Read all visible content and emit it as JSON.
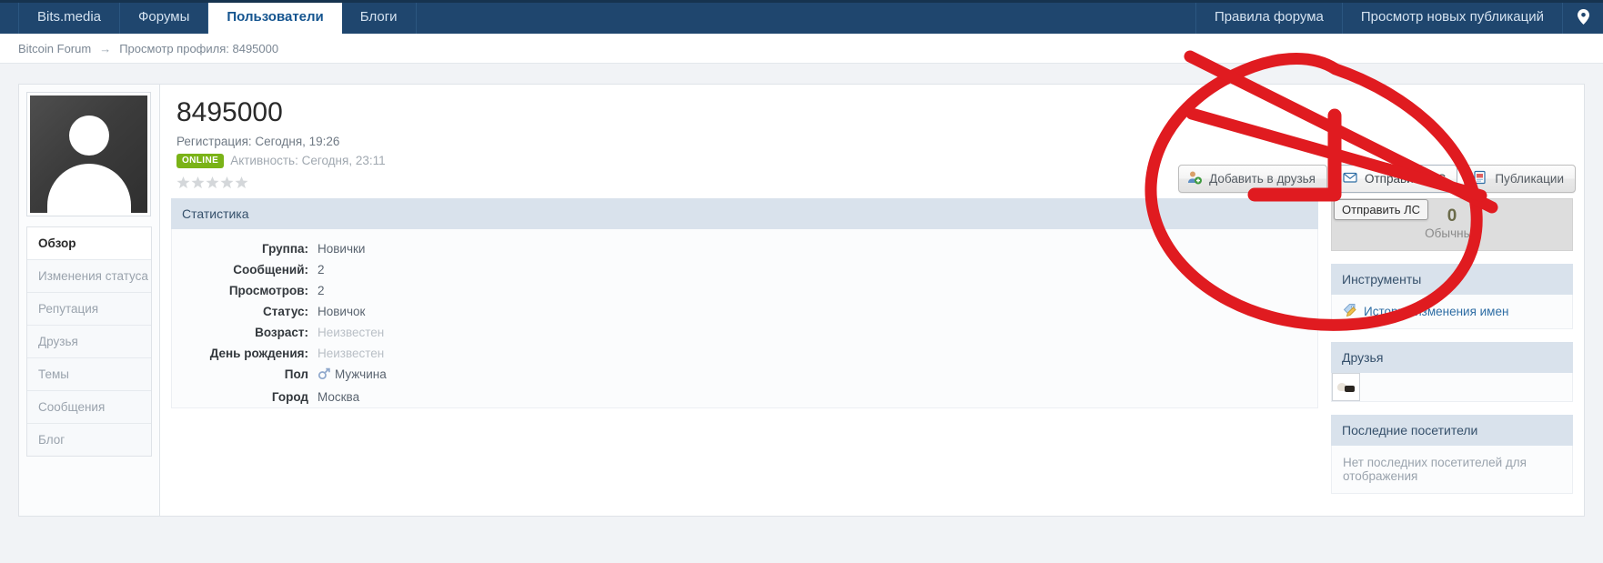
{
  "navbar": {
    "left_items": [
      {
        "label": "Bits.media",
        "active": false
      },
      {
        "label": "Форумы",
        "active": false
      },
      {
        "label": "Пользователи",
        "active": true
      },
      {
        "label": "Блоги",
        "active": false
      }
    ],
    "right_items": [
      {
        "label": "Правила форума"
      },
      {
        "label": "Просмотр новых публикаций"
      }
    ],
    "location_icon": "location-pin-icon",
    "colors": {
      "background": "#1f466e",
      "active_text": "#14548f"
    }
  },
  "breadcrumb": {
    "root": "Bitcoin Forum",
    "separator": "→",
    "current": "Просмотр профиля: 8495000"
  },
  "profile": {
    "avatar_alt": "default-avatar",
    "username": "8495000",
    "registration": "Регистрация: Сегодня, 19:26",
    "online_badge": "ONLINE",
    "activity": "Активность: Сегодня, 23:11",
    "stars": 5,
    "stars_filled": 0
  },
  "profile_tabs": [
    {
      "label": "Обзор",
      "active": true
    },
    {
      "label": "Изменения статуса",
      "active": false
    },
    {
      "label": "Репутация",
      "active": false
    },
    {
      "label": "Друзья",
      "active": false
    },
    {
      "label": "Темы",
      "active": false
    },
    {
      "label": "Сообщения",
      "active": false
    },
    {
      "label": "Блог",
      "active": false
    }
  ],
  "actions": {
    "add_friend": {
      "label": "Добавить в друзья",
      "icon": "add-user-icon"
    },
    "send_pm": {
      "label": "Отправить ЛС",
      "icon": "envelope-icon"
    },
    "posts": {
      "label": "Публикации",
      "icon": "document-icon"
    },
    "tooltip": "Отправить ЛС"
  },
  "statistics": {
    "title": "Статистика",
    "rows": [
      {
        "label": "Группа:",
        "value": "Новички",
        "muted": false
      },
      {
        "label": "Сообщений:",
        "value": "2",
        "muted": false
      },
      {
        "label": "Просмотров:",
        "value": "2",
        "muted": false
      },
      {
        "label": "Статус:",
        "value": "Новичок",
        "muted": false
      },
      {
        "label": "Возраст:",
        "value": "Неизвестен",
        "muted": true
      },
      {
        "label": "День рождения:",
        "value": "Неизвестен",
        "muted": true
      },
      {
        "label": "Пол",
        "value": "Мужчина",
        "muted": false,
        "icon": "male-gender-icon"
      },
      {
        "label": "Город",
        "value": "Москва",
        "muted": false
      }
    ]
  },
  "reputation": {
    "value": "0",
    "label": "Обычный"
  },
  "tools_panel": {
    "title": "Инструменты",
    "items": [
      {
        "label": "История изменения имен",
        "icon": "tag-pencil-icon"
      }
    ]
  },
  "friends_panel": {
    "title": "Друзья",
    "friends": [
      {
        "alt": "friend-avatar-cat"
      }
    ]
  },
  "visitors_panel": {
    "title": "Последние посетители",
    "empty_text": "Нет последних посетителей для отображения"
  },
  "annotation": {
    "type": "hand-drawn-marker",
    "color": "#e01b20",
    "shapes": [
      "circle",
      "arrow",
      "cross-stroke"
    ],
    "target": "Отправить ЛС"
  }
}
